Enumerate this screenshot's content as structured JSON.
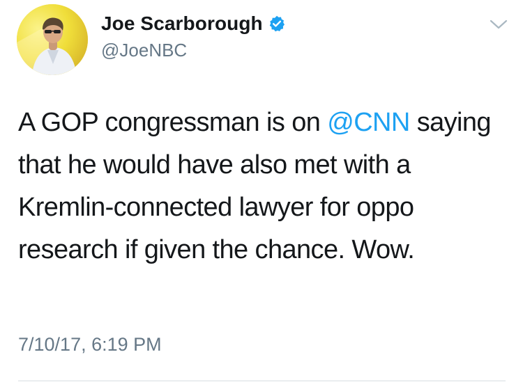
{
  "tweet": {
    "author": {
      "display_name": "Joe Scarborough",
      "handle": "@JoeNBC",
      "verified": true,
      "verified_icon": "verified-badge-icon"
    },
    "text": {
      "part1": "A GOP congressman is on ",
      "mention": "@CNN",
      "part2": " saying that he would have also met with a Kremlin-connected lawyer for oppo research if given the chance. Wow."
    },
    "timestamp": "7/10/17, 6:19 PM",
    "menu_icon": "chevron-down-icon"
  },
  "colors": {
    "text": "#14171a",
    "secondary": "#657786",
    "link": "#1da1f2",
    "verified": "#1da1f2",
    "divider": "#d7dde2"
  }
}
